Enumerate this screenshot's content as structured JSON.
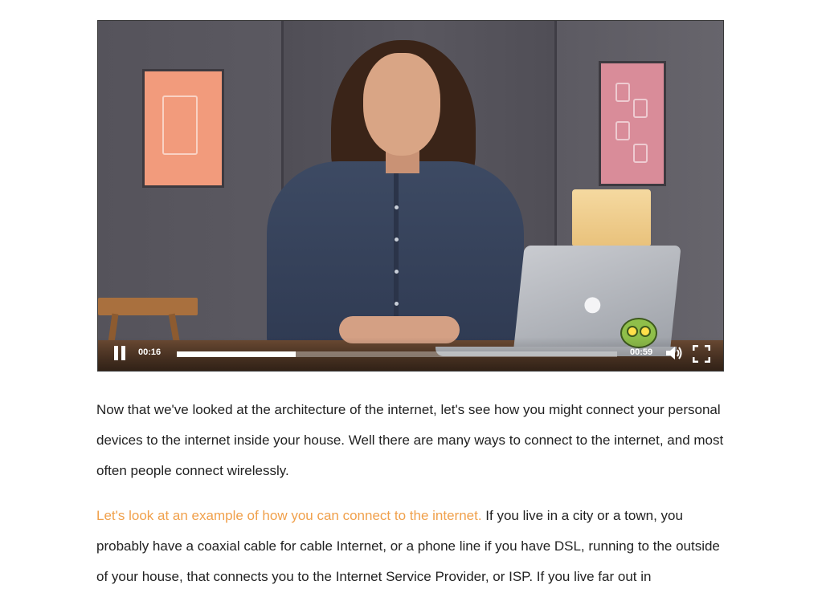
{
  "video": {
    "current_time": "00:16",
    "duration": "00:59",
    "progress_fraction": 0.27
  },
  "transcript": {
    "paragraph1": "Now that we've looked at the architecture of the internet, let's see how you might connect your personal devices to the internet inside your house. Well there are many ways to connect to the internet, and most often people connect wirelessly.",
    "paragraph2_highlight": "Let's look at an example of how you can connect to the internet.",
    "paragraph2_rest": " If you live in a city or a town, you probably have a coaxial cable for cable Internet, or a phone line if you have DSL, running to the outside of your house, that connects you to the Internet Service Provider, or ISP. If you live far out in"
  },
  "colors": {
    "highlight": "#f0a04b",
    "text": "#222222"
  },
  "icons": {
    "play_pause": "pause-icon",
    "volume": "volume-icon",
    "fullscreen": "fullscreen-icon"
  }
}
